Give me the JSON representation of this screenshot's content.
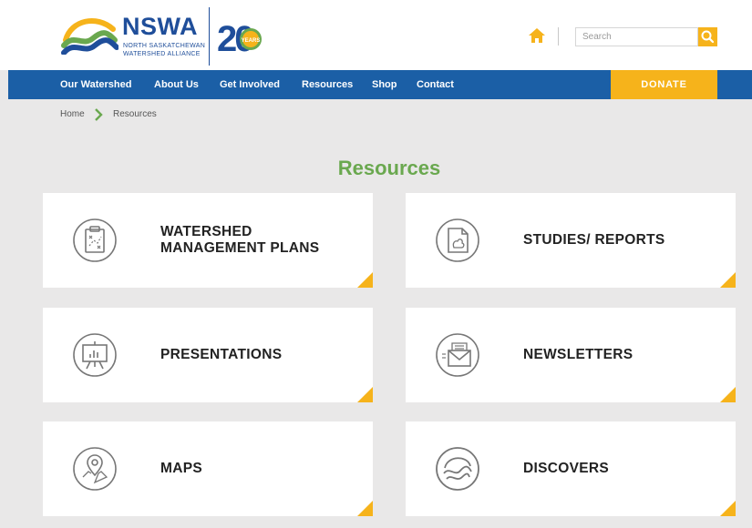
{
  "brand": {
    "title": "NSWA",
    "subtitle_line1": "NORTH SASKATCHEWAN",
    "subtitle_line2": "WATERSHED ALLIANCE",
    "anniversary_number": "20",
    "anniversary_word": "YEARS"
  },
  "search": {
    "placeholder": "Search"
  },
  "nav": {
    "items": [
      "Our Watershed",
      "About Us",
      "Get Involved",
      "Resources",
      "Shop",
      "Contact"
    ],
    "donate": "DONATE"
  },
  "breadcrumb": {
    "home": "Home",
    "current": "Resources"
  },
  "page": {
    "title": "Resources"
  },
  "cards": [
    {
      "label": "WATERSHED MANAGEMENT PLANS",
      "icon": "clipboard-plan-icon"
    },
    {
      "label": "STUDIES/ REPORTS",
      "icon": "report-document-icon"
    },
    {
      "label": "PRESENTATIONS",
      "icon": "presentation-board-icon"
    },
    {
      "label": "NEWSLETTERS",
      "icon": "envelope-icon"
    },
    {
      "label": "MAPS",
      "icon": "map-pin-icon"
    },
    {
      "label": "DISCOVERS",
      "icon": "waves-icon"
    }
  ],
  "colors": {
    "nav_blue": "#1b5fa6",
    "accent_yellow": "#f6b31b",
    "title_green": "#6aa84f",
    "page_bg": "#e9e8e8",
    "brand_blue": "#1f4e9a"
  }
}
